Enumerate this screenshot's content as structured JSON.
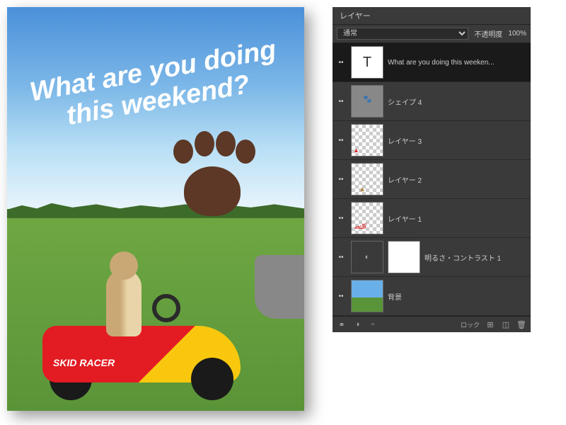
{
  "canvas": {
    "overlay_line1": "What are you doing",
    "overlay_line2": "this weekend?",
    "kart_label": "SKID RACER"
  },
  "panel": {
    "title": "レイヤー",
    "blend_mode": "通常",
    "opacity_label": "不透明度",
    "opacity_value": "100%",
    "lock_label": "ロック",
    "layers": [
      {
        "name": "What are you doing this weeken...",
        "type": "text",
        "visible": true,
        "selected": true
      },
      {
        "name": "シェイプ 4",
        "type": "shape",
        "visible": true,
        "selected": false
      },
      {
        "name": "レイヤー 3",
        "type": "raster",
        "visible": true,
        "selected": false
      },
      {
        "name": "レイヤー 2",
        "type": "raster",
        "visible": true,
        "selected": false
      },
      {
        "name": "レイヤー 1",
        "type": "raster",
        "visible": true,
        "selected": false
      },
      {
        "name": "明るさ・コントラスト 1",
        "type": "adjustment",
        "visible": true,
        "selected": false
      },
      {
        "name": "背景",
        "type": "background",
        "visible": true,
        "selected": false
      }
    ]
  }
}
